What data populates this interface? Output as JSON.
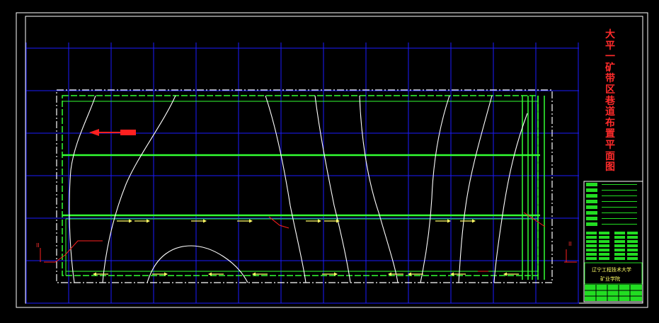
{
  "drawing": {
    "title_chars": [
      "大",
      "平",
      "一",
      "矿",
      "带",
      "区",
      "巷",
      "道",
      "布",
      "置",
      "平",
      "面",
      "图"
    ],
    "section_mark_left": "II",
    "section_mark_right": "II",
    "title_block": {
      "school": "辽宁工程技术大学",
      "department": "矿业学院"
    }
  },
  "colors": {
    "background": "#000000",
    "frame": "#ffffff",
    "grid": "#1c1cff",
    "roadway": "#33ff33",
    "contour": "#ffffff",
    "arrow": "#ffff66",
    "north_arrow": "#ff2020",
    "title": "#ff2b2b",
    "title_block_fill": "#22dd22"
  }
}
